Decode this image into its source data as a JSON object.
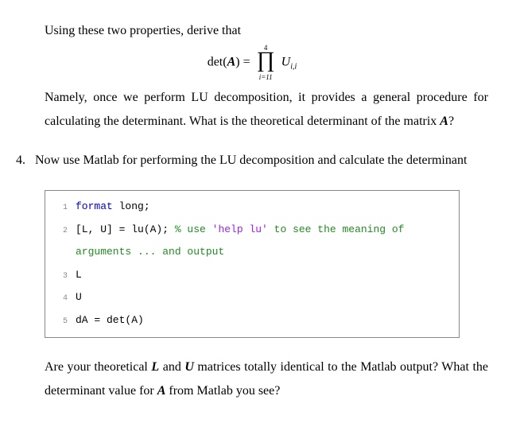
{
  "intro_para1": "Using these two properties, derive that",
  "formula": {
    "det_label": "det(",
    "matrix_var": "A",
    "close_eq": ") = ",
    "prod_upper": "4",
    "prod_symbol": "∏",
    "prod_lower": "i=11",
    "term_var": "U",
    "term_sub": "i,i"
  },
  "intro_para2_a": "Namely, once we perform LU decomposition, it provides a general procedure for calculating the determinant. What is the theoretical determinant of the matrix ",
  "intro_para2_var": "A",
  "intro_para2_b": "?",
  "item4": {
    "number": "4.",
    "text": "Now use Matlab for performing the LU decomposition and calculate the determinant"
  },
  "code": {
    "lines": [
      {
        "no": "1",
        "parts": [
          {
            "cls": "kw",
            "t": "format"
          },
          {
            "cls": "",
            "t": " long;"
          }
        ]
      },
      {
        "no": "2",
        "parts": [
          {
            "cls": "",
            "t": "[L, U] = lu(A); "
          },
          {
            "cls": "com",
            "t": "% use "
          },
          {
            "cls": "str",
            "t": "'help lu'"
          },
          {
            "cls": "com",
            "t": " to see the meaning of arguments ... and output"
          }
        ]
      },
      {
        "no": "3",
        "parts": [
          {
            "cls": "",
            "t": "L"
          }
        ]
      },
      {
        "no": "4",
        "parts": [
          {
            "cls": "",
            "t": "U"
          }
        ]
      },
      {
        "no": "5",
        "parts": [
          {
            "cls": "",
            "t": "dA = det(A)"
          }
        ]
      }
    ]
  },
  "closing_a": "Are your theoretical ",
  "closing_L": "L",
  "closing_b": " and ",
  "closing_U": "U",
  "closing_c": " matrices totally identical to the Matlab output? What the determinant value for ",
  "closing_A": "A",
  "closing_d": " from Matlab you see?"
}
